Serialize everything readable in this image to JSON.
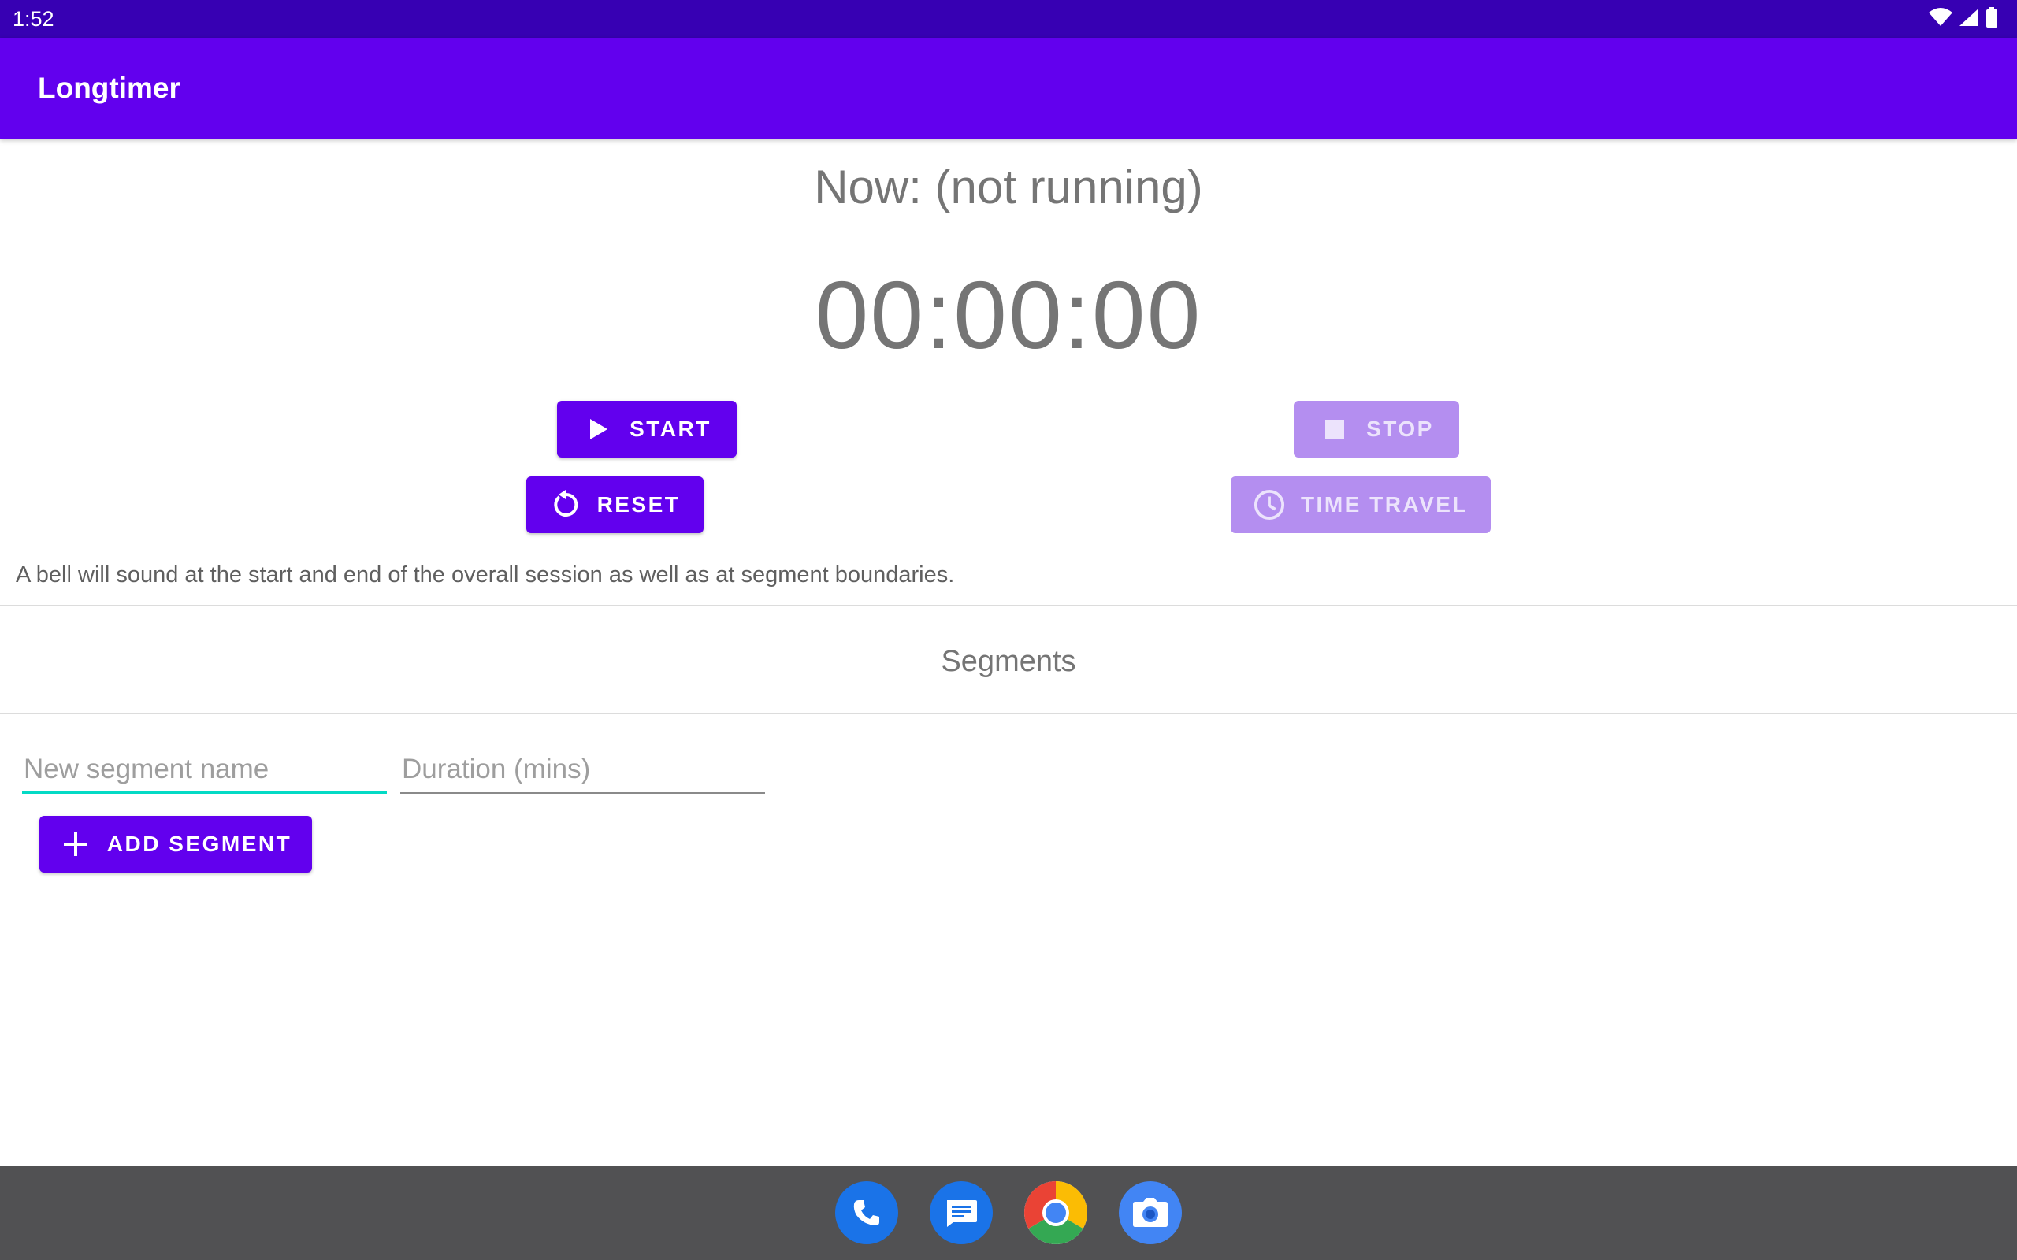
{
  "status_bar": {
    "time": "1:52",
    "icons": [
      "wifi-icon",
      "signal-icon",
      "battery-icon"
    ]
  },
  "app_bar": {
    "title": "Longtimer"
  },
  "timer": {
    "now_label": "Now: (not running)",
    "elapsed": "00:00:00"
  },
  "controls": {
    "start_label": "START",
    "stop_label": "STOP",
    "reset_label": "RESET",
    "time_travel_label": "TIME TRAVEL",
    "stop_enabled": false,
    "time_travel_enabled": false
  },
  "bell_note": "A bell will sound at the start and end of the overall session as well as at segment boundaries.",
  "segments": {
    "title": "Segments",
    "name_field": {
      "value": "",
      "placeholder": "New segment name"
    },
    "duration_field": {
      "value": "",
      "placeholder": "Duration (mins)"
    },
    "add_label": "ADD SEGMENT"
  },
  "dock": {
    "apps": [
      "phone-icon",
      "messages-icon",
      "chrome-icon",
      "camera-icon"
    ]
  },
  "colors": {
    "primary": "#6200ee",
    "primary_dark": "#3700b3",
    "disabled_button": "#b48ef0",
    "focus_accent": "#03dac5",
    "nav_bar": "#515153"
  }
}
